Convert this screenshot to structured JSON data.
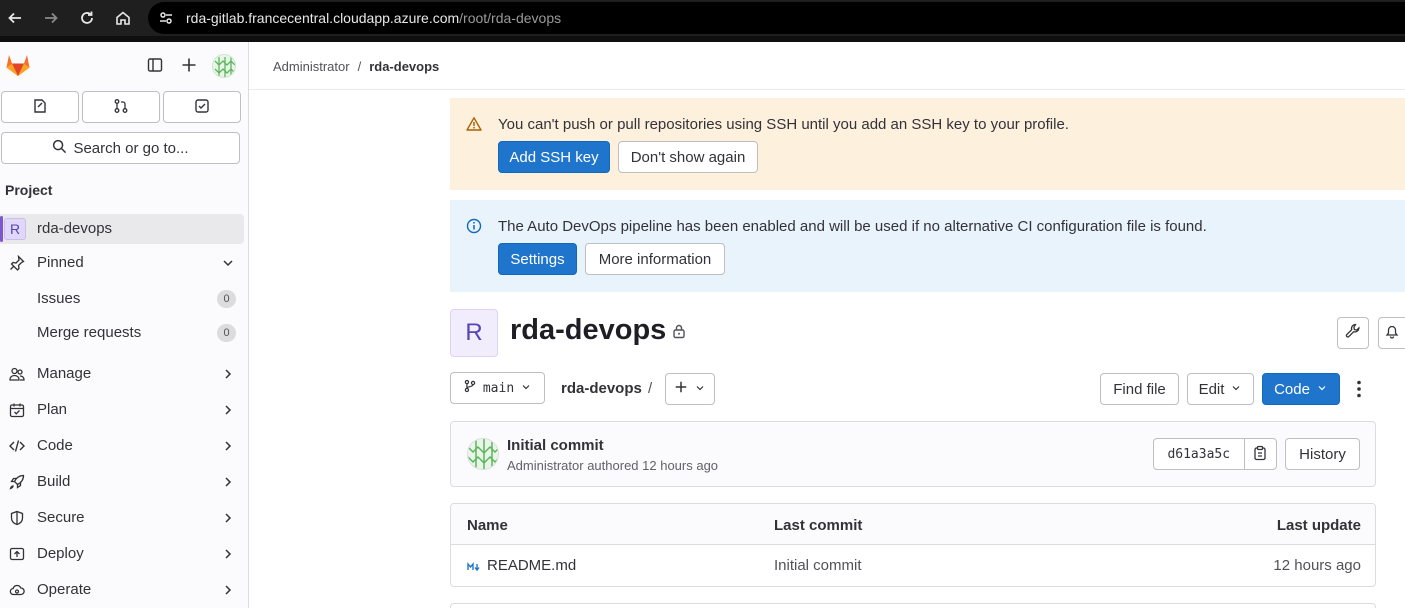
{
  "browser": {
    "url_host": "rda-gitlab.francecentral.cloudapp.azure.com",
    "url_path": "/root/rda-devops"
  },
  "sidebar": {
    "search_label": "Search or go to...",
    "section_heading": "Project",
    "project_avatar_letter": "R",
    "project_name": "rda-devops",
    "pinned_label": "Pinned",
    "pinned_items": [
      {
        "label": "Issues",
        "count": "0"
      },
      {
        "label": "Merge requests",
        "count": "0"
      }
    ],
    "nav_items": [
      {
        "label": "Manage",
        "icon": "users-icon"
      },
      {
        "label": "Plan",
        "icon": "calendar-icon"
      },
      {
        "label": "Code",
        "icon": "code-icon"
      },
      {
        "label": "Build",
        "icon": "rocket-icon"
      },
      {
        "label": "Secure",
        "icon": "shield-icon"
      },
      {
        "label": "Deploy",
        "icon": "deploy-icon"
      },
      {
        "label": "Operate",
        "icon": "cloud-icon"
      }
    ]
  },
  "breadcrumb": {
    "parent": "Administrator",
    "separator": "/",
    "current": "rda-devops"
  },
  "ssh_alert": {
    "text": "You can't push or pull repositories using SSH until you add an SSH key to your profile.",
    "primary_label": "Add SSH key",
    "secondary_label": "Don't show again"
  },
  "devops_alert": {
    "text": "The Auto DevOps pipeline has been enabled and will be used if no alternative CI configuration file is found.",
    "primary_label": "Settings",
    "secondary_label": "More information"
  },
  "project": {
    "avatar_letter": "R",
    "title": "rda-devops"
  },
  "repo_toolbar": {
    "branch": "main",
    "path": "rda-devops",
    "path_separator": "/",
    "find_file_label": "Find file",
    "edit_label": "Edit",
    "code_label": "Code"
  },
  "commit": {
    "title": "Initial commit",
    "author": "Administrator",
    "meta_suffix": "authored 12 hours ago",
    "sha": "d61a3a5c",
    "history_label": "History"
  },
  "file_table": {
    "headers": [
      "Name",
      "Last commit",
      "Last update"
    ],
    "rows": [
      {
        "name": "README.md",
        "last_commit": "Initial commit",
        "last_update": "12 hours ago"
      }
    ]
  },
  "colors": {
    "primary": "#1f75cb",
    "warning_bg": "#fdf1dd",
    "info_bg": "#e9f3fc",
    "warning_icon": "#ab6100",
    "info_icon": "#1068bf"
  }
}
